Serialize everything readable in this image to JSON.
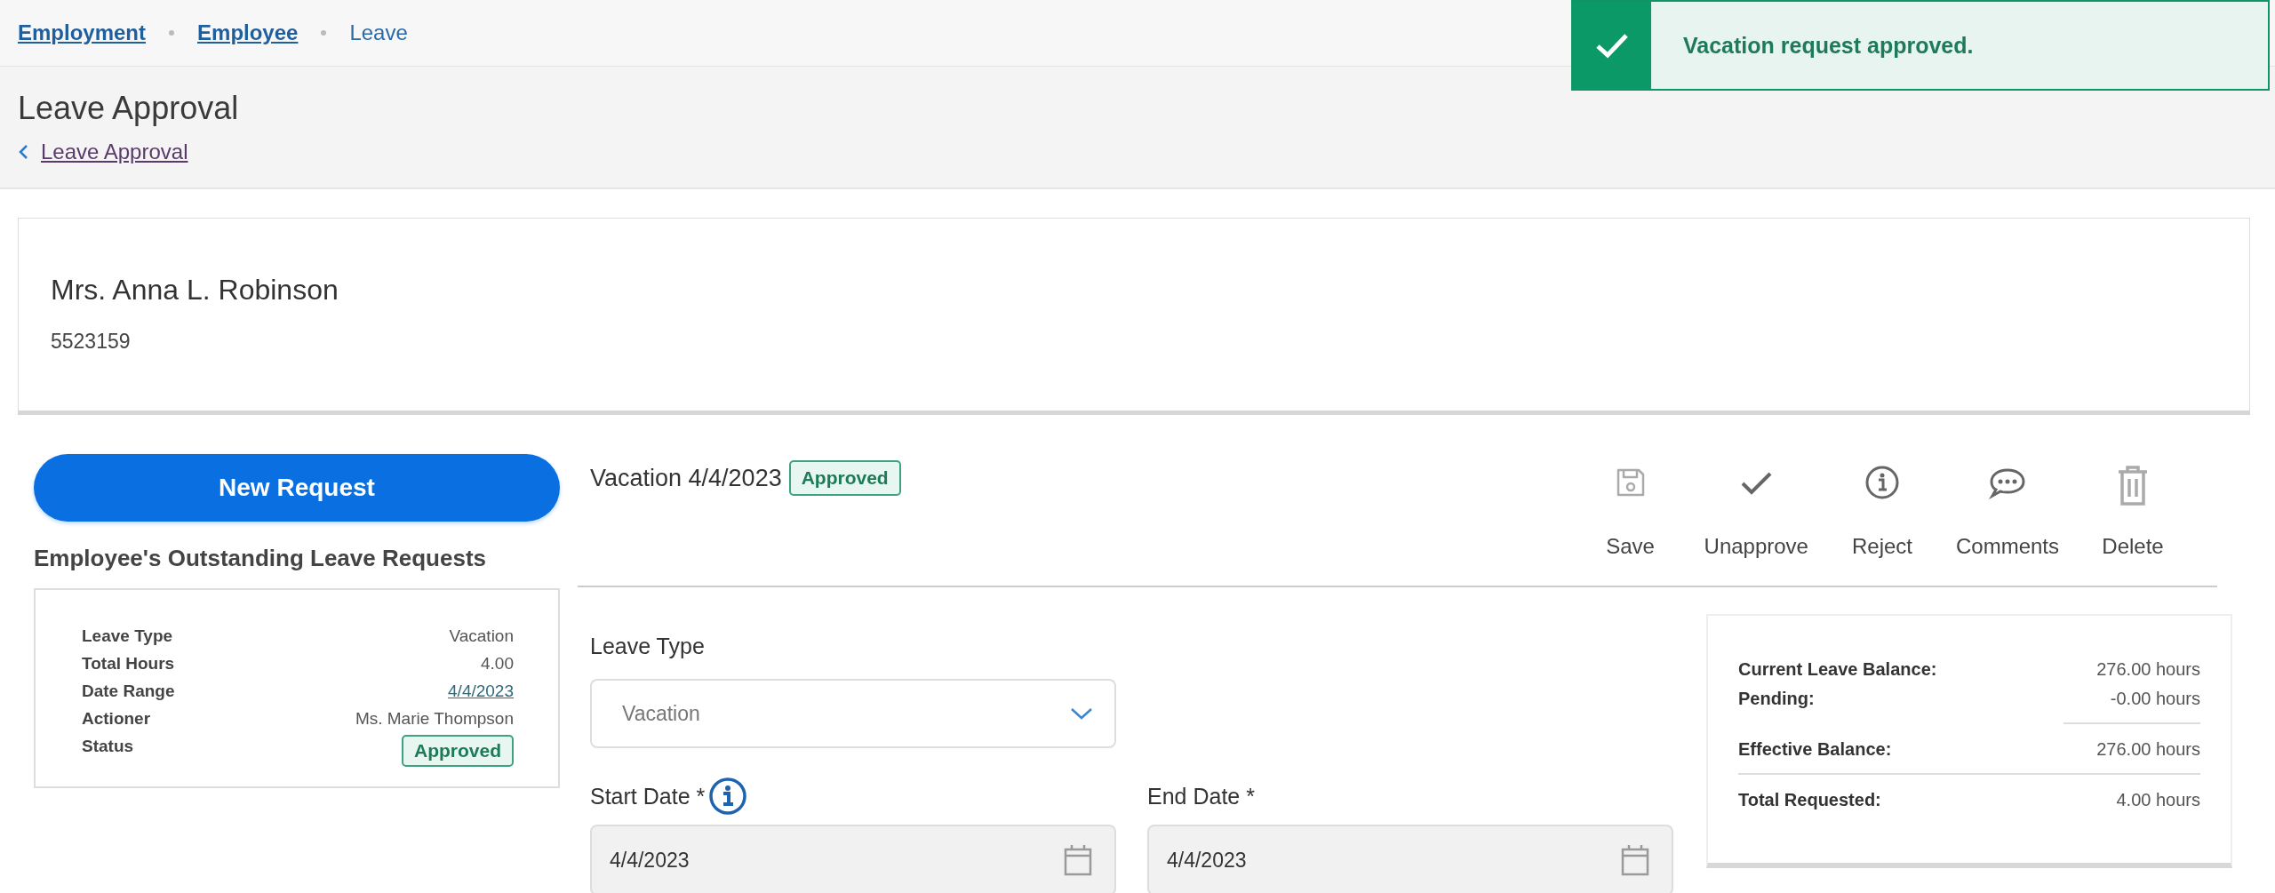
{
  "breadcrumbs": [
    {
      "label": "Employment",
      "kind": "link"
    },
    {
      "label": "Employee",
      "kind": "link"
    },
    {
      "label": "Leave",
      "kind": "current"
    }
  ],
  "page_title": "Leave Approval",
  "back_link": "Leave Approval",
  "toast": {
    "message": "Vacation request approved."
  },
  "employee": {
    "name": "Mrs. Anna L. Robinson",
    "number": "5523159"
  },
  "new_request_button": "New Request",
  "outstanding": {
    "heading": "Employee's Outstanding Leave Requests",
    "rows": [
      {
        "label": "Leave Type",
        "value": "Vacation",
        "kind": "text"
      },
      {
        "label": "Total Hours",
        "value": "4.00",
        "kind": "text"
      },
      {
        "label": "Date Range",
        "value": "4/4/2023",
        "kind": "link"
      },
      {
        "label": "Actioner",
        "value": "Ms. Marie Thompson",
        "kind": "text"
      },
      {
        "label": "Status",
        "value": "Approved",
        "kind": "badge"
      }
    ]
  },
  "request": {
    "title": "Vacation 4/4/2023",
    "status": "Approved"
  },
  "actions": [
    {
      "label": "Save",
      "kind": "save",
      "disabled": true
    },
    {
      "label": "Unapprove",
      "kind": "check",
      "disabled": false
    },
    {
      "label": "Reject",
      "kind": "info",
      "disabled": false
    },
    {
      "label": "Comments",
      "kind": "comment",
      "disabled": false
    },
    {
      "label": "Delete",
      "kind": "trash",
      "disabled": true
    }
  ],
  "form": {
    "leave_type": {
      "label": "Leave Type",
      "value": "Vacation"
    },
    "start_date": {
      "label": "Start Date *",
      "value": "4/4/2023"
    },
    "end_date": {
      "label": "End Date *",
      "value": "4/4/2023"
    }
  },
  "balance": {
    "rows": [
      {
        "label": "Current Leave Balance:",
        "value": "276.00 hours",
        "rule_below": false
      },
      {
        "label": "Pending:",
        "value": "-0.00 hours",
        "rule_below": true,
        "rule_short": true
      },
      {
        "label": "Effective Balance:",
        "value": "276.00 hours",
        "rule_below": true,
        "rule_short": false
      },
      {
        "label": "Total Requested:",
        "value": "4.00 hours",
        "rule_below": false
      }
    ]
  }
}
